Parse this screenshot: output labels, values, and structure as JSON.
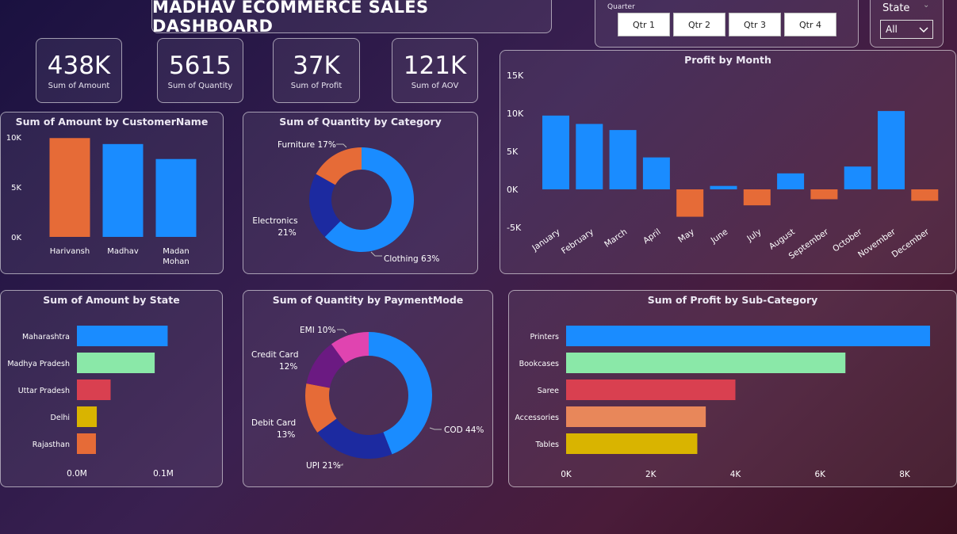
{
  "dashboard": {
    "title": "MADHAV ECOMMERCE SALES DASHBOARD"
  },
  "kpis": [
    {
      "value": "438K",
      "label": "Sum of Amount"
    },
    {
      "value": "5615",
      "label": "Sum of Quantity"
    },
    {
      "value": "37K",
      "label": "Sum of Profit"
    },
    {
      "value": "121K",
      "label": "Sum of AOV"
    }
  ],
  "quarter_slicer": {
    "label": "Quarter",
    "options": [
      "Qtr 1",
      "Qtr 2",
      "Qtr 3",
      "Qtr 4"
    ]
  },
  "state_slicer": {
    "label": "State",
    "selected": "All"
  },
  "colors": {
    "blue": "#1a8cff",
    "orange": "#e66b37",
    "navy": "#1c2aa0",
    "purple": "#6b1a82",
    "pink": "#e044b0",
    "green": "#8ae8a8",
    "red": "#d94050",
    "yellow": "#d9b400",
    "salmon": "#e8875a"
  },
  "chart_data": [
    {
      "id": "customer",
      "type": "bar",
      "title": "Sum of Amount by CustomerName",
      "categories": [
        "Harivansh",
        "Madhav",
        "Madan Mohan"
      ],
      "values": [
        9900,
        9300,
        7800
      ],
      "bar_colors": [
        "#e66b37",
        "#1a8cff",
        "#1a8cff"
      ],
      "ylim": [
        0,
        10000
      ],
      "yticks": [
        0,
        5000,
        10000
      ],
      "ytick_labels": [
        "0K",
        "5K",
        "10K"
      ]
    },
    {
      "id": "category",
      "type": "pie",
      "title": "Sum of Quantity by Category",
      "labels": [
        "Clothing",
        "Electronics",
        "Furniture"
      ],
      "values": [
        63,
        21,
        17
      ],
      "display_labels": [
        "Clothing 63%",
        "Electronics 21%",
        "Furniture 17%"
      ],
      "colors": [
        "#1a8cff",
        "#1c2aa0",
        "#e66b37"
      ]
    },
    {
      "id": "month",
      "type": "bar",
      "title": "Profit by Month",
      "categories": [
        "January",
        "February",
        "March",
        "April",
        "May",
        "June",
        "July",
        "August",
        "September",
        "October",
        "November",
        "December"
      ],
      "values": [
        9700,
        8600,
        7800,
        4200,
        -3600,
        450,
        -2100,
        2100,
        -1300,
        3000,
        10300,
        -1500
      ],
      "ylim": [
        -5000,
        15000
      ],
      "yticks": [
        -5000,
        0,
        5000,
        10000,
        15000
      ],
      "ytick_labels": [
        "-5K",
        "0K",
        "5K",
        "10K",
        "15K"
      ],
      "positive_color": "#1a8cff",
      "negative_color": "#e66b37"
    },
    {
      "id": "state",
      "type": "bar",
      "title": "Sum of Amount by State",
      "orientation": "horizontal",
      "categories": [
        "Maharashtra",
        "Madhya Pradesh",
        "Uttar Pradesh",
        "Delhi",
        "Rajasthan"
      ],
      "values": [
        105000,
        90000,
        39000,
        23000,
        22000
      ],
      "bar_colors": [
        "#1a8cff",
        "#8ae8a8",
        "#d94050",
        "#d9b400",
        "#e66b37"
      ],
      "xlim": [
        0,
        100000
      ],
      "xticks": [
        0,
        100000
      ],
      "xtick_labels": [
        "0.0M",
        "0.1M"
      ]
    },
    {
      "id": "payment",
      "type": "pie",
      "title": "Sum of Quantity by PaymentMode",
      "labels": [
        "COD",
        "UPI",
        "Debit Card",
        "Credit Card",
        "EMI"
      ],
      "values": [
        44,
        21,
        13,
        12,
        10
      ],
      "display_labels": [
        "COD 44%",
        "UPI 21%",
        "Debit Card 13%",
        "Credit Card 12%",
        "EMI 10%"
      ],
      "colors": [
        "#1a8cff",
        "#1c2aa0",
        "#e66b37",
        "#6b1a82",
        "#e044b0"
      ]
    },
    {
      "id": "subcat",
      "type": "bar",
      "title": "Sum of Profit by Sub-Category",
      "orientation": "horizontal",
      "categories": [
        "Printers",
        "Bookcases",
        "Saree",
        "Accessories",
        "Tables"
      ],
      "values": [
        8600,
        6600,
        4000,
        3300,
        3100
      ],
      "bar_colors": [
        "#1a8cff",
        "#8ae8a8",
        "#d94050",
        "#e8875a",
        "#d9b400"
      ],
      "xlim": [
        0,
        8000
      ],
      "xticks": [
        0,
        2000,
        4000,
        6000,
        8000
      ],
      "xtick_labels": [
        "0K",
        "2K",
        "4K",
        "6K",
        "8K"
      ]
    }
  ]
}
